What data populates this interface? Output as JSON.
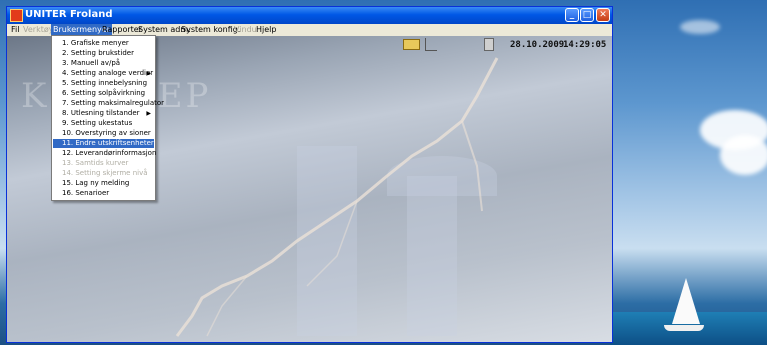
{
  "window": {
    "title": "UNITER Froland",
    "buttons": {
      "minimize": "_",
      "maximize": "□",
      "close": "✕"
    }
  },
  "menubar": {
    "items": [
      {
        "label": "Fil",
        "state": "normal"
      },
      {
        "label": "Verktøy",
        "state": "disabled"
      },
      {
        "label": "Brukermenyer",
        "state": "active"
      },
      {
        "label": "Rapporter",
        "state": "normal"
      },
      {
        "label": "System adm.",
        "state": "normal"
      },
      {
        "label": "System konfig.",
        "state": "normal"
      },
      {
        "label": "Vindu",
        "state": "disabled"
      },
      {
        "label": "Hjelp",
        "state": "normal"
      }
    ]
  },
  "status": {
    "date": "28.10.2009",
    "time": "14:29:05",
    "icons": [
      "folder-icon",
      "chart-icon",
      "trash-icon"
    ]
  },
  "background": {
    "watermark": "KLERVEP"
  },
  "dropdown": {
    "items": [
      {
        "label": "1. Grafiske menyer",
        "state": "normal",
        "submenu": false
      },
      {
        "label": "2. Setting brukstider",
        "state": "normal",
        "submenu": false
      },
      {
        "label": "3. Manuell av/på",
        "state": "normal",
        "submenu": false
      },
      {
        "label": "4. Setting analoge verdier",
        "state": "normal",
        "submenu": true
      },
      {
        "label": "5. Setting innebelysning",
        "state": "normal",
        "submenu": false
      },
      {
        "label": "6. Setting solpåvirkning",
        "state": "normal",
        "submenu": false
      },
      {
        "label": "7. Setting maksimalregulator",
        "state": "normal",
        "submenu": false
      },
      {
        "label": "8. Utlesning tilstander",
        "state": "normal",
        "submenu": true
      },
      {
        "label": "9. Setting ukestatus",
        "state": "normal",
        "submenu": false
      },
      {
        "label": "10. Overstyring av sioner",
        "state": "normal",
        "submenu": false
      },
      {
        "label": "11. Endre utskriftsenheter",
        "state": "highlight",
        "submenu": false
      },
      {
        "label": "12. Leverandørinformasjon",
        "state": "normal",
        "submenu": false
      },
      {
        "label": "13. Samtids kurver",
        "state": "disabled",
        "submenu": false
      },
      {
        "label": "14. Setting skjerme nivå",
        "state": "disabled",
        "submenu": false
      },
      {
        "label": "15. Lag ny melding",
        "state": "normal",
        "submenu": false
      },
      {
        "label": "16. Senarioer",
        "state": "normal",
        "submenu": false
      }
    ]
  },
  "colors": {
    "titlebar": "#0058e6",
    "menu_highlight": "#316ac5",
    "menubar_bg": "#ece9d8"
  }
}
